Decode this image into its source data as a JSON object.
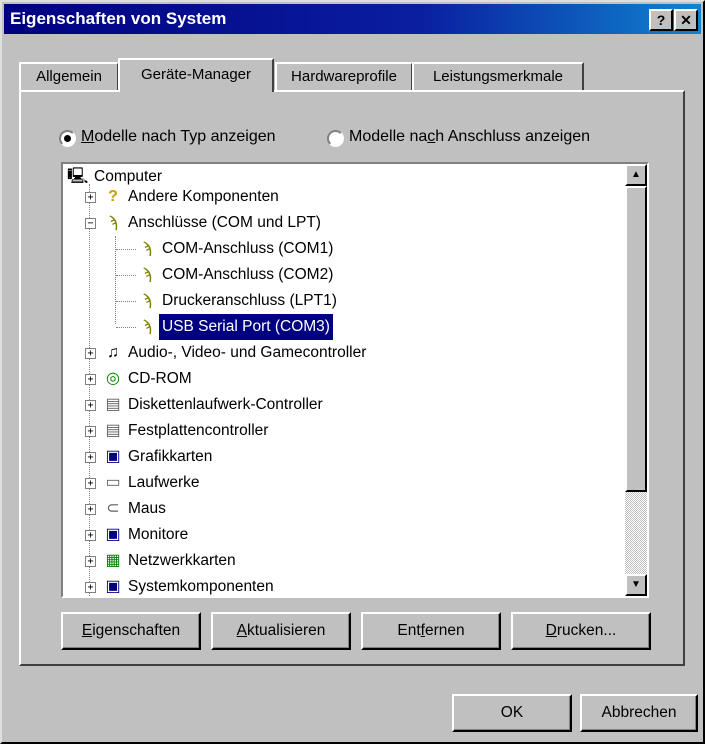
{
  "window": {
    "title": "Eigenschaften von System",
    "help_glyph": "?",
    "close_glyph": "✕"
  },
  "tabs": [
    {
      "label": "Allgemein"
    },
    {
      "label": "Geräte-Manager",
      "active": true
    },
    {
      "label": "Hardwareprofile"
    },
    {
      "label": "Leistungsmerkmale"
    }
  ],
  "view_options": {
    "by_type": {
      "pre": "",
      "key": "M",
      "post": "odelle nach Typ anzeigen",
      "selected": true
    },
    "by_connection": {
      "pre": "Modelle na",
      "key": "c",
      "post": "h Anschluss anzeigen",
      "selected": false
    }
  },
  "tree": {
    "root": "Computer",
    "items": [
      {
        "label": "Andere Komponenten",
        "icon": "question-icon"
      },
      {
        "label": "Anschlüsse (COM und LPT)",
        "icon": "port-icon",
        "expanded": true,
        "children": [
          {
            "label": "COM-Anschluss (COM1)"
          },
          {
            "label": "COM-Anschluss (COM2)"
          },
          {
            "label": "Druckeranschluss (LPT1)"
          },
          {
            "label": "USB Serial Port (COM3)",
            "selected": true
          }
        ]
      },
      {
        "label": "Audio-, Video- und Gamecontroller",
        "icon": "audio-icon"
      },
      {
        "label": "CD-ROM",
        "icon": "cdrom-icon"
      },
      {
        "label": "Diskettenlaufwerk-Controller",
        "icon": "floppy-controller-icon"
      },
      {
        "label": "Festplattencontroller",
        "icon": "disk-controller-icon"
      },
      {
        "label": "Grafikkarten",
        "icon": "display-adapter-icon"
      },
      {
        "label": "Laufwerke",
        "icon": "drive-icon"
      },
      {
        "label": "Maus",
        "icon": "mouse-icon"
      },
      {
        "label": "Monitore",
        "icon": "monitor-icon"
      },
      {
        "label": "Netzwerkkarten",
        "icon": "network-card-icon"
      },
      {
        "label": "Systemkomponenten",
        "icon": "system-icon"
      }
    ]
  },
  "actions": {
    "properties": {
      "pre": "",
      "key": "E",
      "post": "igenschaften"
    },
    "refresh": {
      "pre": "",
      "key": "A",
      "post": "ktualisieren"
    },
    "remove": {
      "pre": "Ent",
      "key": "f",
      "post": "ernen"
    },
    "print": {
      "pre": "",
      "key": "D",
      "post": "rucken..."
    }
  },
  "dialog": {
    "ok": "OK",
    "cancel": "Abbrechen"
  },
  "colors": {
    "titlebar": "#000080",
    "face": "#c0c0c0",
    "selection": "#000080"
  }
}
